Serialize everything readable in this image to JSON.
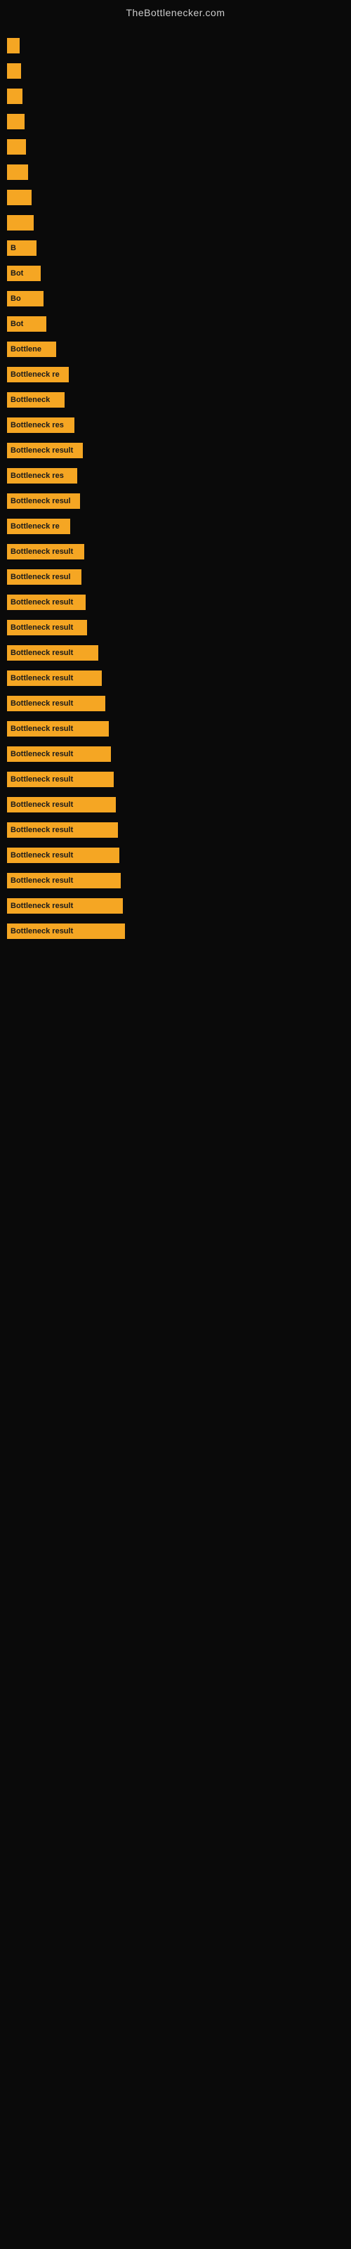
{
  "site": {
    "title": "TheBottlenecker.com"
  },
  "bars": [
    {
      "width": 18,
      "label": ""
    },
    {
      "width": 20,
      "label": ""
    },
    {
      "width": 22,
      "label": ""
    },
    {
      "width": 25,
      "label": ""
    },
    {
      "width": 27,
      "label": ""
    },
    {
      "width": 30,
      "label": ""
    },
    {
      "width": 35,
      "label": ""
    },
    {
      "width": 38,
      "label": ""
    },
    {
      "width": 42,
      "label": "B"
    },
    {
      "width": 48,
      "label": "Bot"
    },
    {
      "width": 52,
      "label": "Bo"
    },
    {
      "width": 56,
      "label": "Bot"
    },
    {
      "width": 70,
      "label": "Bottlene"
    },
    {
      "width": 88,
      "label": "Bottleneck re"
    },
    {
      "width": 82,
      "label": "Bottleneck"
    },
    {
      "width": 96,
      "label": "Bottleneck res"
    },
    {
      "width": 108,
      "label": "Bottleneck result"
    },
    {
      "width": 100,
      "label": "Bottleneck res"
    },
    {
      "width": 104,
      "label": "Bottleneck resul"
    },
    {
      "width": 90,
      "label": "Bottleneck re"
    },
    {
      "width": 110,
      "label": "Bottleneck result"
    },
    {
      "width": 106,
      "label": "Bottleneck resul"
    },
    {
      "width": 112,
      "label": "Bottleneck result"
    },
    {
      "width": 114,
      "label": "Bottleneck result"
    },
    {
      "width": 130,
      "label": "Bottleneck result"
    },
    {
      "width": 135,
      "label": "Bottleneck result"
    },
    {
      "width": 140,
      "label": "Bottleneck result"
    },
    {
      "width": 145,
      "label": "Bottleneck result"
    },
    {
      "width": 148,
      "label": "Bottleneck result"
    },
    {
      "width": 152,
      "label": "Bottleneck result"
    },
    {
      "width": 155,
      "label": "Bottleneck result"
    },
    {
      "width": 158,
      "label": "Bottleneck result"
    },
    {
      "width": 160,
      "label": "Bottleneck result"
    },
    {
      "width": 162,
      "label": "Bottleneck result"
    },
    {
      "width": 165,
      "label": "Bottleneck result"
    },
    {
      "width": 168,
      "label": "Bottleneck result"
    }
  ]
}
